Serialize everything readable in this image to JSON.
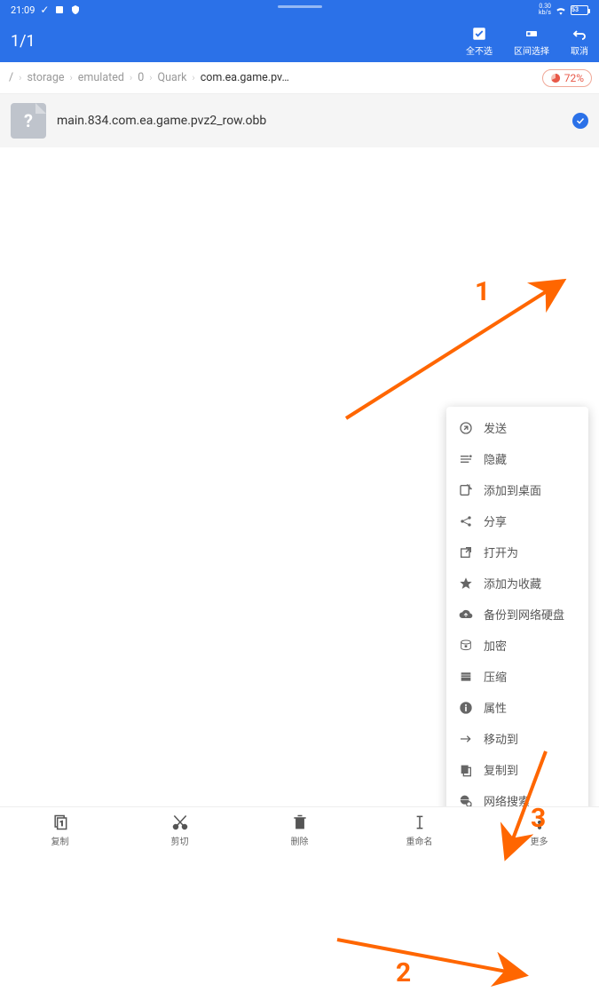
{
  "status": {
    "time": "21:09",
    "net_speed": "0.30",
    "net_unit": "kb/s",
    "battery": "53"
  },
  "header": {
    "counter": "1/1",
    "deselect_all": "全不选",
    "range_select": "区间选择",
    "cancel": "取消"
  },
  "breadcrumb": {
    "segments": [
      "/",
      "storage",
      "emulated",
      "0",
      "Quark",
      "com.ea.game.pv…"
    ]
  },
  "storage_badge": "72%",
  "file": {
    "name": "main.834.com.ea.game.pvz2_row.obb",
    "icon_label": "?"
  },
  "popup": {
    "items": [
      {
        "label": "发送",
        "icon": "send"
      },
      {
        "label": "隐藏",
        "icon": "hide"
      },
      {
        "label": "添加到桌面",
        "icon": "add-desktop"
      },
      {
        "label": "分享",
        "icon": "share"
      },
      {
        "label": "打开为",
        "icon": "open-as"
      },
      {
        "label": "添加为收藏",
        "icon": "favorite"
      },
      {
        "label": "备份到网络硬盘",
        "icon": "cloud-backup"
      },
      {
        "label": "加密",
        "icon": "encrypt"
      },
      {
        "label": "压缩",
        "icon": "compress"
      },
      {
        "label": "属性",
        "icon": "properties"
      },
      {
        "label": "移动到",
        "icon": "move-to"
      },
      {
        "label": "复制到",
        "icon": "copy-to"
      },
      {
        "label": "网络搜索",
        "icon": "search-web"
      }
    ]
  },
  "bottom": {
    "copy": "复制",
    "cut": "剪切",
    "delete": "删除",
    "rename": "重命名",
    "more": "更多"
  },
  "annotations": {
    "l1": "1",
    "l2": "2",
    "l3": "3"
  }
}
